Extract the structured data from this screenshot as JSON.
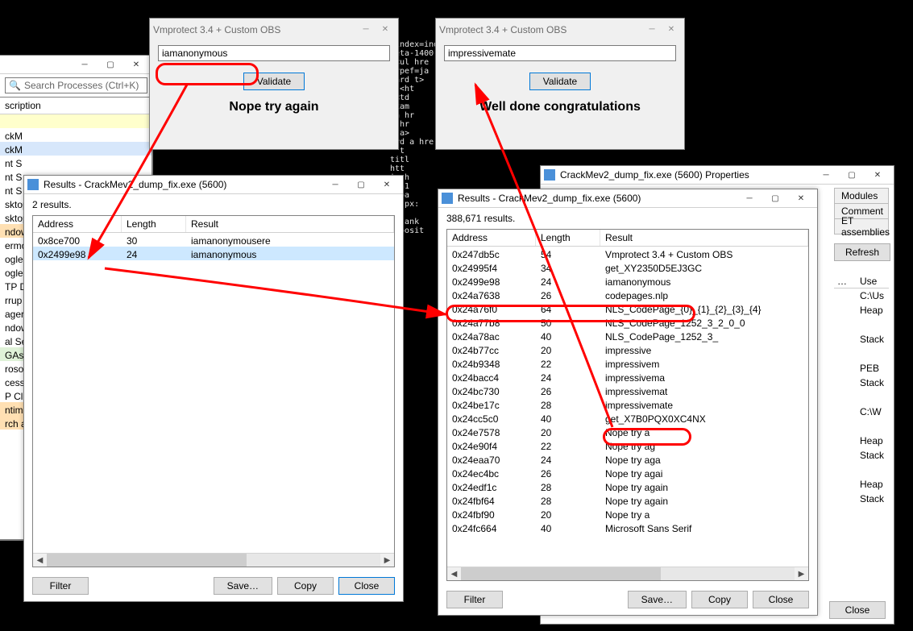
{
  "codebg": ".index=indexOfname+='=1) return\nmeta-1400-\n}<ul hre\ntypef=ja\noard t>\ns:<ht\ns<td\nExam\n-a hr\na hr\n</a>\nard a hre\n' t\ntitl\nhtt\n|a h\n</h1\n<boa\nid px:\nt\n<blank\n>=posit",
  "leftWin": {
    "searchPlaceholder": "Search Processes (Ctrl+K)",
    "colHeader": "scription",
    "rows": [
      "",
      "ckM",
      "ckM",
      "nt S",
      "nt S",
      "nt S",
      "sktop",
      "sktop",
      "ndow",
      "ermo",
      "ogle",
      "ogle",
      "TP D",
      "rrup",
      "ager",
      "ndow",
      "al Se",
      "GAsy",
      "roso",
      "cess",
      "P Clip",
      "ntim",
      "rch a"
    ],
    "rowClasses": [
      "highlight-yellow",
      "",
      "highlight-blue",
      "",
      "",
      "",
      "",
      "",
      "highlight-orange",
      "",
      "",
      "",
      "",
      "",
      "",
      "",
      "",
      "highlight-green",
      "",
      "",
      "",
      "highlight-orange",
      "highlight-orange"
    ]
  },
  "vm1": {
    "title": "Vmprotect  3.4 + Custom OBS",
    "inputValue": "iamanonymous",
    "validateLabel": "Validate",
    "msg": "Nope try again"
  },
  "vm2": {
    "title": "Vmprotect  3.4 + Custom OBS",
    "inputValue": "impressivemate",
    "validateLabel": "Validate",
    "msg": "Well done congratulations"
  },
  "results1": {
    "title": "Results - CrackMev2_dump_fix.exe (5600)",
    "countText": "2 results.",
    "headers": {
      "address": "Address",
      "length": "Length",
      "result": "Result"
    },
    "rows": [
      {
        "a": "0x8ce700",
        "l": "30",
        "r": "iamanonymousere"
      },
      {
        "a": "0x2499e98",
        "l": "24",
        "r": "iamanonymous"
      }
    ],
    "buttons": {
      "filter": "Filter",
      "save": "Save…",
      "copy": "Copy",
      "close": "Close"
    }
  },
  "results2": {
    "title": "Results - CrackMev2_dump_fix.exe (5600)",
    "countText": "388,671 results.",
    "headers": {
      "address": "Address",
      "length": "Length",
      "result": "Result"
    },
    "rows": [
      {
        "a": "0x247db5c",
        "l": "54",
        "r": "Vmprotect  3.4 + Custom OBS"
      },
      {
        "a": "0x24995f4",
        "l": "34",
        "r": "get_XY2350D5EJ3GC"
      },
      {
        "a": "0x2499e98",
        "l": "24",
        "r": "iamanonymous"
      },
      {
        "a": "0x24a7638",
        "l": "26",
        "r": "codepages.nlp"
      },
      {
        "a": "0x24a76f0",
        "l": "64",
        "r": "NLS_CodePage_{0}_{1}_{2}_{3}_{4}"
      },
      {
        "a": "0x24a77b8",
        "l": "50",
        "r": "NLS_CodePage_1252_3_2_0_0"
      },
      {
        "a": "0x24a78ac",
        "l": "40",
        "r": "NLS_CodePage_1252_3_"
      },
      {
        "a": "0x24b77cc",
        "l": "20",
        "r": "impressive"
      },
      {
        "a": "0x24b9348",
        "l": "22",
        "r": "impressivem"
      },
      {
        "a": "0x24bacc4",
        "l": "24",
        "r": "impressivema"
      },
      {
        "a": "0x24bc730",
        "l": "26",
        "r": "impressivemat"
      },
      {
        "a": "0x24be17c",
        "l": "28",
        "r": "impressivemate"
      },
      {
        "a": "0x24cc5c0",
        "l": "40",
        "r": "get_X7B0PQX0XC4NX"
      },
      {
        "a": "0x24e7578",
        "l": "20",
        "r": "Nope try a"
      },
      {
        "a": "0x24e90f4",
        "l": "22",
        "r": "Nope try ag"
      },
      {
        "a": "0x24eaa70",
        "l": "24",
        "r": "Nope try aga"
      },
      {
        "a": "0x24ec4bc",
        "l": "26",
        "r": "Nope try agai"
      },
      {
        "a": "0x24edf1c",
        "l": "28",
        "r": "Nope try again"
      },
      {
        "a": "0x24fbf64",
        "l": "28",
        "r": "Nope try again"
      },
      {
        "a": "0x24fbf90",
        "l": "20",
        "r": "Nope try a"
      },
      {
        "a": "0x24fc664",
        "l": "40",
        "r": "Microsoft Sans Serif"
      }
    ],
    "buttons": {
      "filter": "Filter",
      "save": "Save…",
      "copy": "Copy",
      "close": "Close"
    }
  },
  "props": {
    "title": "CrackMev2_dump_fix.exe (5600) Properties",
    "tabs": [
      "Modules",
      "Comment",
      "ET assemblies"
    ],
    "refresh": "Refresh",
    "close": "Close",
    "useHeader": "Use",
    "items": [
      "C:\\Us",
      "Heap",
      "",
      "Stack",
      "",
      "PEB",
      "Stack",
      "",
      "C:\\W",
      "",
      "Heap",
      "Stack",
      "",
      "Heap",
      "Stack"
    ]
  }
}
